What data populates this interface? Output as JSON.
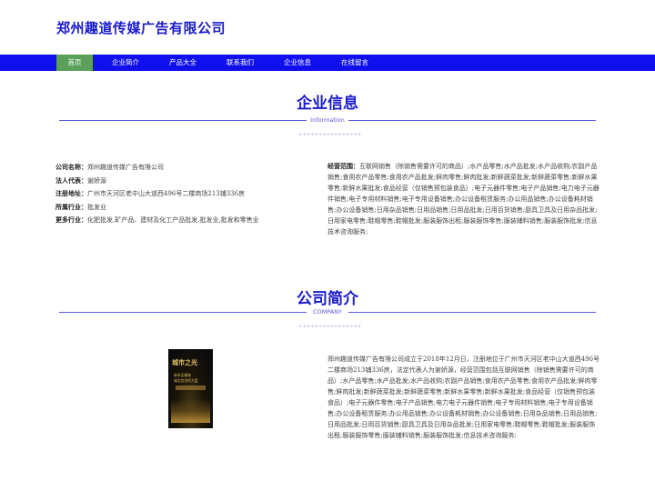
{
  "site": {
    "title": "郑州趣道传媒广告有限公司"
  },
  "nav": {
    "items": [
      {
        "label": "首页",
        "active": true
      },
      {
        "label": "企业简介",
        "active": false
      },
      {
        "label": "产品大全",
        "active": false
      },
      {
        "label": "联系我们",
        "active": false
      },
      {
        "label": "企业信息",
        "active": false
      },
      {
        "label": "在线留言",
        "active": false
      }
    ]
  },
  "company_info": {
    "title": "企业信息",
    "subtitle": "Information",
    "divider": "----------------",
    "fields": [
      {
        "label": "公司名称：",
        "value": "郑州趣道传媒广告有限公司"
      },
      {
        "label": "法人代表：",
        "value": "谢娇源"
      },
      {
        "label": "注册地址：",
        "value": "广州市天河区老中山大道西496号二楼商场213铺336房"
      },
      {
        "label": "所属行业：",
        "value": "批发业"
      },
      {
        "label": "更多行业：",
        "value": "化肥批发,矿产品、建材及化工产品批发,批发业,批发和零售业"
      }
    ],
    "scope_label": "经营范围：",
    "scope_value": "互联网销售（除销售需要许可的商品）;水产品零售;水产品批发;水产品收购;农副产品销售;食用农产品零售;食用农产品批发;鲜肉零售;鲜肉批发;新鲜蔬菜批发;新鲜蔬菜零售;新鲜水果零售;新鲜水果批发;食品经营（仅销售预包装食品）;电子元器件零售;电子产品销售;电力电子元器件销售;电子专用材料销售;电子专用设备销售;办公设备租赁服务;办公用品销售;办公设备耗材销售;办公设备销售;日用杂品销售;日用品销售;日用品批发;日用百货销售;厨具卫具及日用杂品批发;日用家电零售;鞋帽零售;鞋帽批发;服装服饰出租;服装服饰零售;服装辅料销售;服装服饰批发;信息技术咨询服务;"
  },
  "company_intro": {
    "title": "公司简介",
    "subtitle": "COMPANY",
    "divider": "----------------",
    "poster": {
      "title": "城市之光",
      "line1": "新市区精装",
      "line2": "城北宜学的大盘"
    },
    "text": "郑州趣道传媒广告有限公司成立于2018年12月日，注册地位于广州市天河区老中山大道西496号二楼商场213铺336房，法定代表人为谢娇源，经营范围包括互联网销售（除销售需要许可的商品）;水产品零售;水产品批发;水产品收购;农副产品销售;食用农产品零售;食用农产品批发;鲜肉零售;鲜肉批发;新鲜蔬菜批发;新鲜蔬菜零售;新鲜水果零售;新鲜水果批发;食品经营（仅销售预包装食品）;电子元器件零售;电子产品销售;电力电子元器件销售;电子专用材料销售;电子专用设备销售;办公设备租赁服务;办公用品销售;办公设备耗材销售;办公设备销售;日用杂品销售;日用品销售;日用品批发;日用百货销售;厨具卫具及日用杂品批发;日用家电零售;鞋帽零售;鞋帽批发;服装服饰出租;服装服饰零售;服装辅料销售;服装服饰批发;信息技术咨询服务;"
  }
}
